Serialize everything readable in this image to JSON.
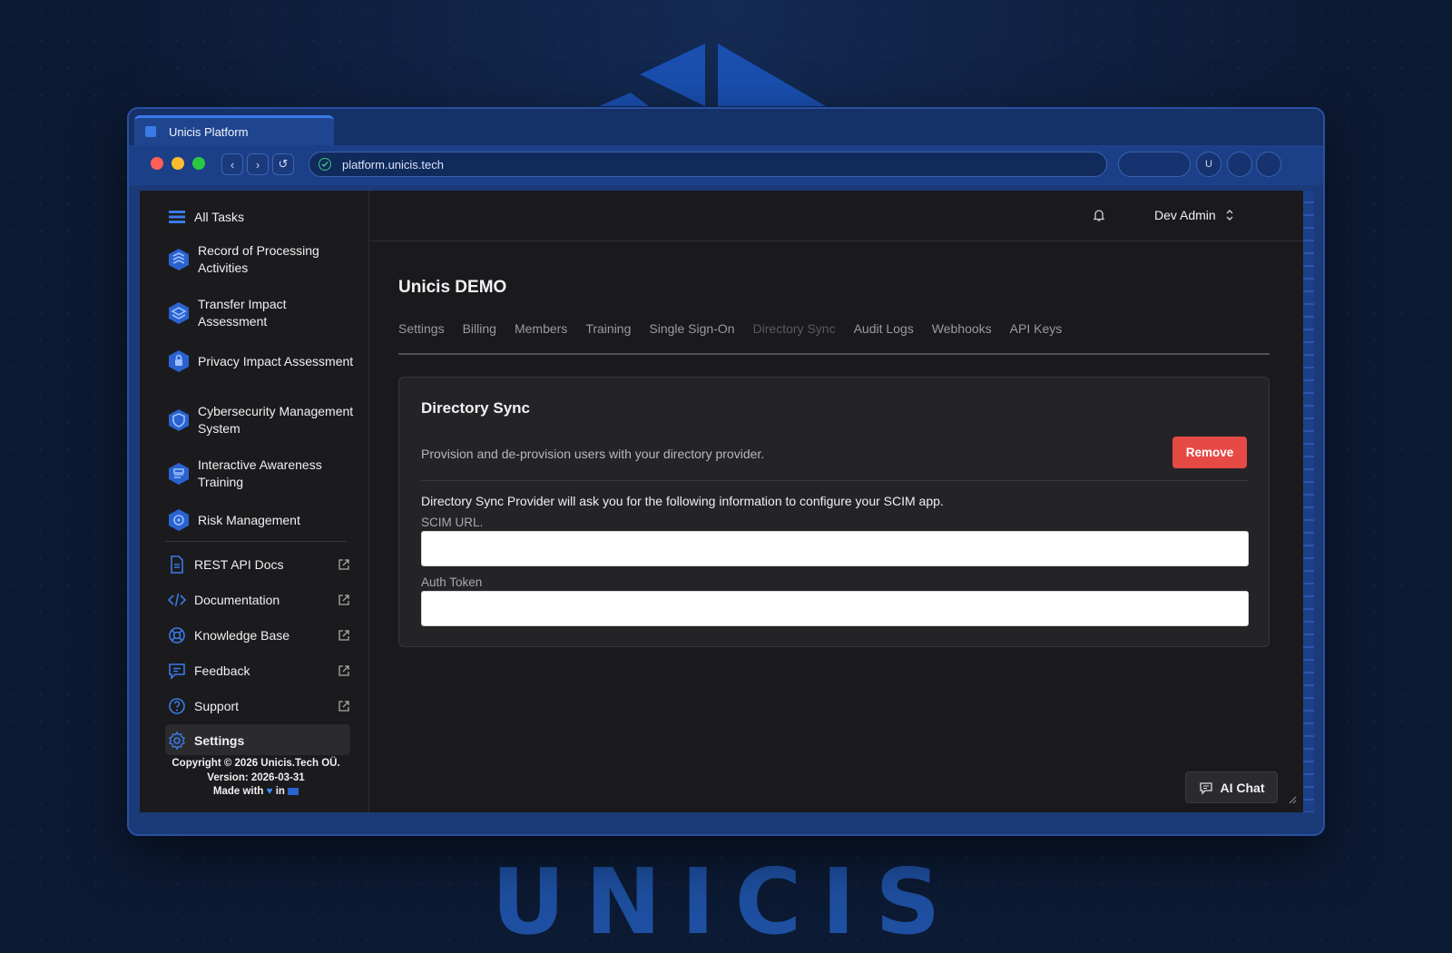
{
  "browser": {
    "tab_title": "Unicis Platform",
    "url": "platform.unicis.tech",
    "profile_initial": "U"
  },
  "sidebar": {
    "primary": [
      {
        "label": "All Tasks",
        "icon": "list-icon"
      },
      {
        "label": "Record of Processing Activities",
        "icon": "ropa-module-icon"
      },
      {
        "label": "Transfer Impact Assessment",
        "icon": "tia-module-icon"
      },
      {
        "label": "Privacy Impact Assessment",
        "icon": "pia-module-icon"
      },
      {
        "label": "Cybersecurity Management System",
        "icon": "csms-module-icon"
      },
      {
        "label": "Interactive Awareness Training",
        "icon": "iat-module-icon"
      },
      {
        "label": "Risk Management",
        "icon": "risk-module-icon"
      }
    ],
    "secondary": [
      {
        "label": "REST API Docs",
        "icon": "document-icon"
      },
      {
        "label": "Documentation",
        "icon": "code-icon"
      },
      {
        "label": "Knowledge Base",
        "icon": "lifebuoy-icon"
      },
      {
        "label": "Feedback",
        "icon": "chat-bubble-icon"
      },
      {
        "label": "Support",
        "icon": "question-circle-icon"
      }
    ],
    "settings_label": "Settings",
    "footer": {
      "copyright": "Copyright © 2026 Unicis.Tech OÜ.",
      "version": "Version: 2026-03-31",
      "made_with": "Made with",
      "in": "in"
    }
  },
  "header": {
    "user_name": "Dev Admin"
  },
  "main": {
    "title": "Unicis DEMO",
    "tabs": [
      {
        "label": "Settings",
        "active": false
      },
      {
        "label": "Billing",
        "active": false
      },
      {
        "label": "Members",
        "active": false
      },
      {
        "label": "Training",
        "active": false
      },
      {
        "label": "Single Sign-On",
        "active": false
      },
      {
        "label": "Directory Sync",
        "active": true
      },
      {
        "label": "Audit Logs",
        "active": false
      },
      {
        "label": "Webhooks",
        "active": false
      },
      {
        "label": "API Keys",
        "active": false
      }
    ],
    "card": {
      "title": "Directory Sync",
      "description": "Provision and de-provision users with your directory provider.",
      "remove_label": "Remove",
      "info": "Directory Sync Provider will ask you for the following information to configure your SCIM app.",
      "scim_label": "SCIM URL.",
      "scim_value": "",
      "token_label": "Auth Token",
      "token_value": ""
    }
  },
  "ai_chat_label": "AI Chat",
  "brand_wordmark": "UNICIS",
  "colors": {
    "accent": "#3b7ae8",
    "danger": "#e64a45",
    "background": "#0c1a33"
  }
}
